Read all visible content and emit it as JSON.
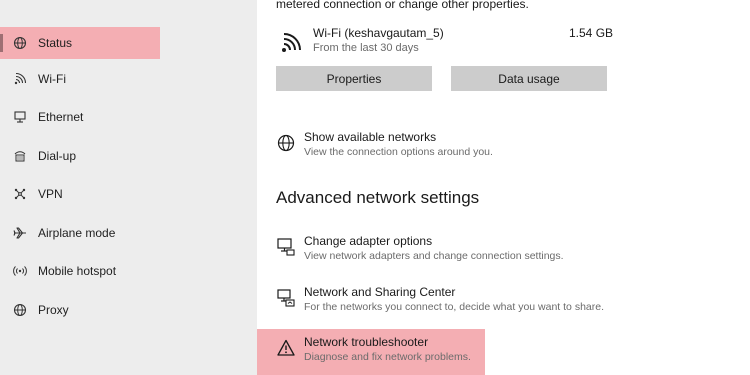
{
  "sidebar": {
    "items": [
      {
        "label": "Status",
        "icon": "globe-icon",
        "active": true
      },
      {
        "label": "Wi-Fi",
        "icon": "wifi-icon"
      },
      {
        "label": "Ethernet",
        "icon": "ethernet-icon"
      },
      {
        "label": "Dial-up",
        "icon": "dialup-icon"
      },
      {
        "label": "VPN",
        "icon": "vpn-icon"
      },
      {
        "label": "Airplane mode",
        "icon": "airplane-icon"
      },
      {
        "label": "Mobile hotspot",
        "icon": "hotspot-icon"
      },
      {
        "label": "Proxy",
        "icon": "globe-icon"
      }
    ],
    "highlight_color": "#f4aeb3"
  },
  "main": {
    "truncated_text": "metered connection or change other properties.",
    "network": {
      "name": "Wi-Fi (keshavgautam_5)",
      "subtitle": "From the last 30 days",
      "usage": "1.54 GB",
      "icon": "wifi-icon"
    },
    "buttons": {
      "properties": "Properties",
      "data_usage": "Data usage"
    },
    "show_networks": {
      "title": "Show available networks",
      "description": "View the connection options around you.",
      "icon": "globe-icon"
    },
    "advanced_heading": "Advanced network settings",
    "advanced_items": [
      {
        "title": "Change adapter options",
        "description": "View network adapters and change connection settings.",
        "icon": "adapter-icon"
      },
      {
        "title": "Network and Sharing Center",
        "description": "For the networks you connect to, decide what you want to share.",
        "icon": "sharing-icon"
      },
      {
        "title": "Network troubleshooter",
        "description": "Diagnose and fix network problems.",
        "icon": "warning-icon",
        "highlighted": true
      }
    ]
  }
}
